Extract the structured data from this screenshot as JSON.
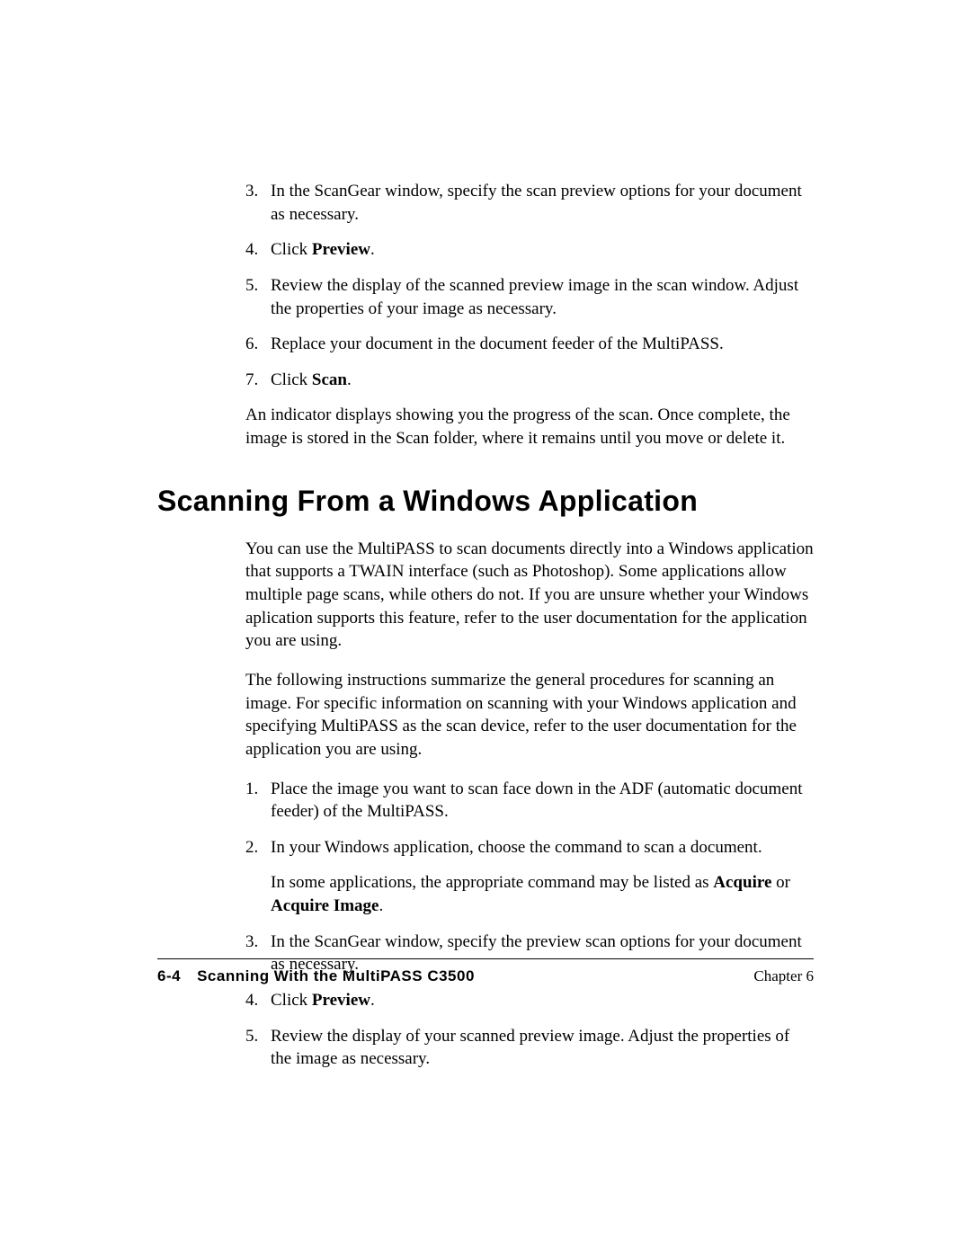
{
  "top_list": [
    {
      "num": "3.",
      "text": "In the ScanGear window, specify the scan preview options for your document as necessary."
    },
    {
      "num": "4.",
      "pre": "Click ",
      "bold": "Preview",
      "post": "."
    },
    {
      "num": "5.",
      "text": "Review the display of the scanned preview image in the scan window. Adjust the properties of your image as necessary."
    },
    {
      "num": "6.",
      "text": "Replace your document in the document feeder of the MultiPASS."
    },
    {
      "num": "7.",
      "pre": "Click ",
      "bold": "Scan",
      "post": "."
    }
  ],
  "para_after_top": "An indicator displays showing you the progress of the scan. Once complete, the image is stored in the Scan folder, where it remains until you move or delete it.",
  "heading": "Scanning From a Windows Application",
  "section_para1": "You can use the MultiPASS to scan documents directly into a Windows application that supports a TWAIN interface (such as Photoshop). Some applications allow multiple page scans, while others do not. If you are unsure whether your Windows aplication supports this feature, refer to the user documentation for the application you are using.",
  "section_para2": "The following instructions summarize the general procedures for scanning an image. For specific information on scanning with your Windows application and specifying MultiPASS as the scan device, refer to the user documentation for the application you are using.",
  "bottom_list": [
    {
      "num": "1.",
      "text": "Place the image you want to scan face down in the ADF (automatic document feeder) of the MultiPASS."
    },
    {
      "num": "2.",
      "text": "In your Windows application, choose the command to scan a document.",
      "sub_pre": "In some applications, the appropriate command may be listed as ",
      "sub_bold1": "Acquire",
      "sub_mid": " or ",
      "sub_bold2": "Acquire Image",
      "sub_post": "."
    },
    {
      "num": "3.",
      "text": "In the ScanGear window, specify the preview scan options for your document as necessary."
    },
    {
      "num": "4.",
      "pre": "Click ",
      "bold": "Preview",
      "post": "."
    },
    {
      "num": "5.",
      "text": "Review the display of your scanned preview image. Adjust the properties of the image as necessary."
    }
  ],
  "footer": {
    "pagenum": "6-4",
    "title": "Scanning With the MultiPASS C3500",
    "chapter": "Chapter 6"
  }
}
